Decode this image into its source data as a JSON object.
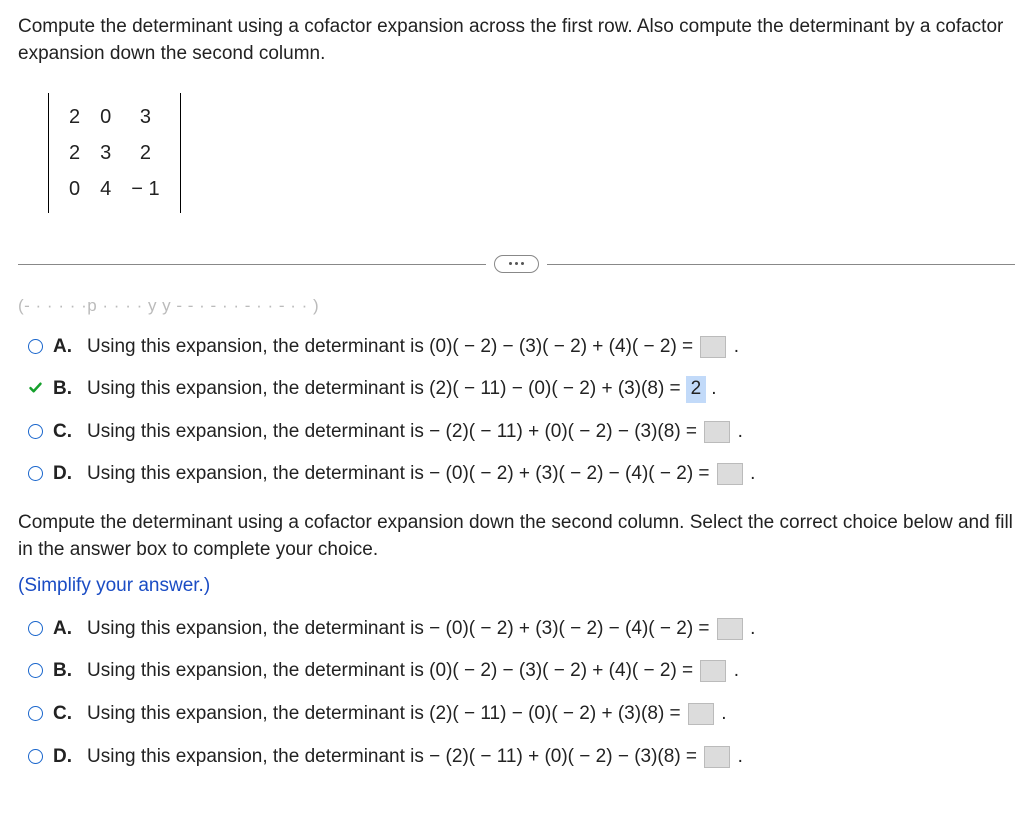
{
  "question": {
    "prompt": "Compute the determinant using a cofactor expansion across the first row. Also compute the determinant by a cofactor expansion down the second column.",
    "matrix": [
      [
        "2",
        "0",
        "3"
      ],
      [
        "2",
        "3",
        "2"
      ],
      [
        "0",
        "4",
        "− 1"
      ]
    ]
  },
  "clipped_hint": "(- · · · · ·p · · · · y  y - - ·  - · · - · · - · · )",
  "part1": {
    "choices": {
      "A": {
        "label": "A.",
        "text_prefix": "Using this expansion, the determinant is (0)( − 2) − (3)( − 2) + (4)( − 2) = ",
        "filled": "",
        "selected": false
      },
      "B": {
        "label": "B.",
        "text_prefix": "Using this expansion, the determinant is (2)( − 11) − (0)( − 2) + (3)(8) = ",
        "filled": "2",
        "selected": true
      },
      "C": {
        "label": "C.",
        "text_prefix": "Using this expansion, the determinant is  − (2)( − 11) + (0)( − 2) − (3)(8) = ",
        "filled": "",
        "selected": false
      },
      "D": {
        "label": "D.",
        "text_prefix": "Using this expansion, the determinant is  − (0)( − 2) + (3)( − 2) − (4)( − 2) = ",
        "filled": "",
        "selected": false
      }
    }
  },
  "part2": {
    "prompt": "Compute the determinant using a cofactor expansion down the second column. Select the correct choice below and fill in the answer box to complete your choice.",
    "note": "(Simplify your answer.)",
    "choices": {
      "A": {
        "label": "A.",
        "text_prefix": "Using this expansion, the determinant is  − (0)( − 2) + (3)( − 2) − (4)( − 2) = ",
        "filled": "",
        "selected": false
      },
      "B": {
        "label": "B.",
        "text_prefix": "Using this expansion, the determinant is (0)( − 2) − (3)( − 2) + (4)( − 2) = ",
        "filled": "",
        "selected": false
      },
      "C": {
        "label": "C.",
        "text_prefix": "Using this expansion, the determinant is (2)( − 11) − (0)( − 2) + (3)(8) = ",
        "filled": "",
        "selected": false
      },
      "D": {
        "label": "D.",
        "text_prefix": "Using this expansion, the determinant is  − (2)( − 11) + (0)( − 2) − (3)(8) = ",
        "filled": "",
        "selected": false
      }
    }
  }
}
